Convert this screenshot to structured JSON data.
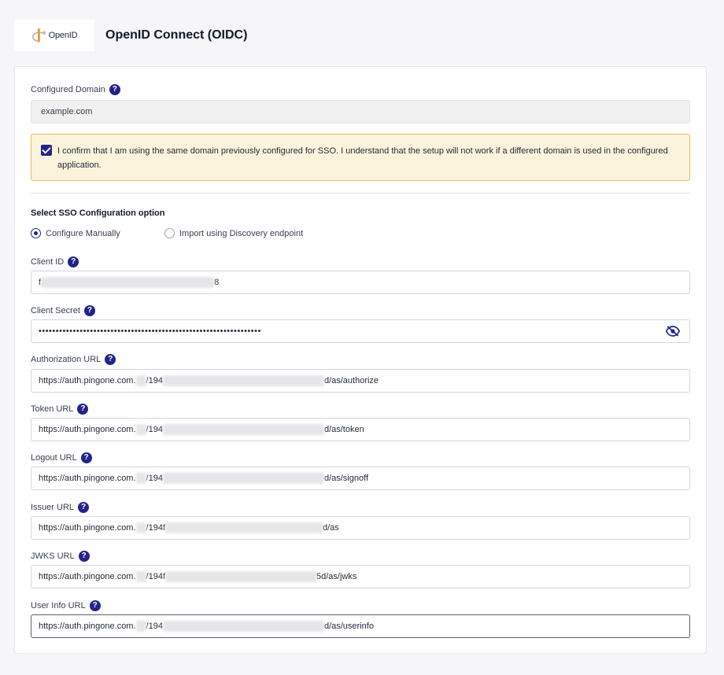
{
  "header": {
    "logo_text": "OpenID",
    "title": "OpenID Connect (OIDC)"
  },
  "form": {
    "configured_domain": {
      "label": "Configured Domain",
      "value": "example.com"
    },
    "confirm": {
      "checked": true,
      "text": "I confirm that I am using the same domain previously configured for SSO. I understand that the setup will not work if a different domain is used in the configured application."
    },
    "sso_option": {
      "title": "Select SSO Configuration option",
      "options": [
        {
          "label": "Configure Manually",
          "selected": true
        },
        {
          "label": "Import using Discovery endpoint",
          "selected": false
        }
      ]
    },
    "client_id": {
      "label": "Client ID",
      "prefix": "f",
      "suffix": "8"
    },
    "client_secret": {
      "label": "Client Secret",
      "value": "•••••••••••••••••••••••••••••••••••••••••••••••••••••••••••••••••"
    },
    "authorization_url": {
      "label": "Authorization URL",
      "prefix": "https://auth.pingone.com.",
      "mid": "/194",
      "suffix": "d/as/authorize"
    },
    "token_url": {
      "label": "Token URL",
      "prefix": "https://auth.pingone.com.",
      "mid": "/194",
      "suffix": "d/as/token"
    },
    "logout_url": {
      "label": "Logout URL",
      "prefix": "https://auth.pingone.com.",
      "mid": "/194",
      "suffix": "d/as/signoff"
    },
    "issuer_url": {
      "label": "Issuer URL",
      "prefix": "https://auth.pingone.com.",
      "mid": "/194f",
      "suffix": "d/as"
    },
    "jwks_url": {
      "label": "JWKS URL",
      "prefix": "https://auth.pingone.com.",
      "mid": "/194f",
      "suffix": "5d/as/jwks"
    },
    "userinfo_url": {
      "label": "User Info URL",
      "prefix": "https://auth.pingone.com.",
      "mid": "/194",
      "suffix": "d/as/userinfo"
    }
  },
  "colors": {
    "accent": "#22238a",
    "warning_bg": "#fcf3dd",
    "warning_border": "#eabb62"
  }
}
